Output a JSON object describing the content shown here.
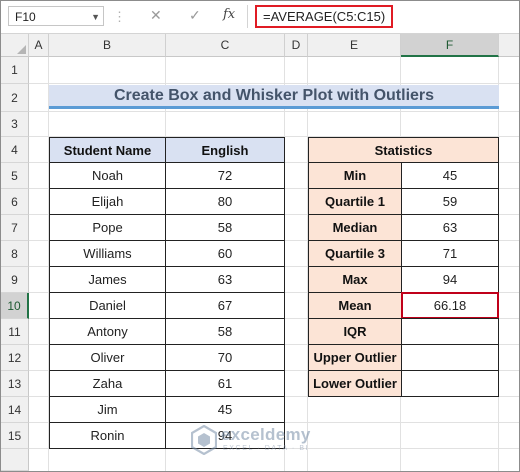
{
  "formula_bar": {
    "name_box": "F10",
    "cancel_glyph": "✕",
    "enter_glyph": "✓",
    "fx_label": "fx",
    "formula": "=AVERAGE(C5:C15)"
  },
  "columns": [
    "A",
    "B",
    "C",
    "D",
    "E",
    "F"
  ],
  "selected_column": "F",
  "rows": [
    "1",
    "2",
    "3",
    "4",
    "5",
    "6",
    "7",
    "8",
    "9",
    "10",
    "11",
    "12",
    "13",
    "14",
    "15"
  ],
  "selected_row": "10",
  "title": "Create Box and Whisker Plot with Outliers",
  "students_table": {
    "headers": [
      "Student Name",
      "English"
    ],
    "rows": [
      {
        "name": "Noah",
        "score": "72"
      },
      {
        "name": "Elijah",
        "score": "80"
      },
      {
        "name": "Pope",
        "score": "58"
      },
      {
        "name": "Williams",
        "score": "60"
      },
      {
        "name": "James",
        "score": "63"
      },
      {
        "name": "Daniel",
        "score": "67"
      },
      {
        "name": "Antony",
        "score": "58"
      },
      {
        "name": "Oliver",
        "score": "70"
      },
      {
        "name": "Zaha",
        "score": "61"
      },
      {
        "name": "Jim",
        "score": "45"
      },
      {
        "name": "Ronin",
        "score": "94"
      }
    ]
  },
  "stats_table": {
    "header": "Statistics",
    "rows": [
      {
        "label": "Min",
        "value": "45"
      },
      {
        "label": "Quartile 1",
        "value": "59"
      },
      {
        "label": "Median",
        "value": "63"
      },
      {
        "label": "Quartile 3",
        "value": "71"
      },
      {
        "label": "Max",
        "value": "94"
      },
      {
        "label": "Mean",
        "value": "66.18"
      },
      {
        "label": "IQR",
        "value": ""
      },
      {
        "label": "Upper Outlier",
        "value": ""
      },
      {
        "label": "Lower Outlier",
        "value": ""
      }
    ]
  },
  "watermark": {
    "name": "exceldemy",
    "tagline": "EXCEL · DATA · BI"
  },
  "colors": {
    "header_blue": "#d9e1f2",
    "header_peach": "#fce4d6",
    "title_text": "#44546a",
    "title_underline": "#5b9bd5",
    "highlight_red": "#e01b24",
    "excel_green": "#217346"
  }
}
